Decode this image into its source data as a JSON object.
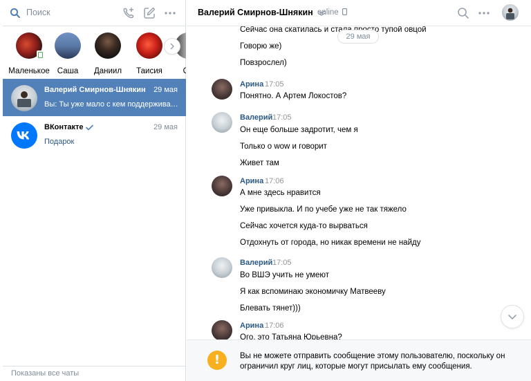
{
  "colors": {
    "accent": "#5181b8",
    "link": "#2a5885",
    "warning": "#f8b020"
  },
  "search": {
    "placeholder": "Поиск"
  },
  "toolbar": {
    "icons": [
      "call-plus-icon",
      "compose-icon",
      "more-icon"
    ]
  },
  "stories": [
    {
      "name": "Маленькое",
      "online": true
    },
    {
      "name": "Саша",
      "online": false
    },
    {
      "name": "Даниил",
      "online": false
    },
    {
      "name": "Таисия",
      "online": false
    },
    {
      "name": "Се",
      "online": false
    }
  ],
  "chats": [
    {
      "name": "Валерий Смирнов-Шнякин",
      "date": "29 мая",
      "message": "Вы: Ты уже мало с кем поддерживаешь общение",
      "active": true
    },
    {
      "name": "ВКонтакте",
      "date": "29 мая",
      "message": "Подарок",
      "verified": true,
      "active": false
    }
  ],
  "left_footer": "Показаны все чаты",
  "header": {
    "name": "Валерий Смирнов-Шнякин",
    "status": "online"
  },
  "date_divider": "29 мая",
  "messages": {
    "top_line_0": "Сейчас она скатилась и стала просто тупой овцой",
    "top_line_1": "Говорю же)",
    "top_line_2": "Повзрослел)",
    "g1": {
      "author": "Арина",
      "time": "17:05",
      "lines": [
        "Понятно. А Артем Локостов?"
      ]
    },
    "g2": {
      "author": "Валерий",
      "time": "17:05",
      "lines": [
        "Он еще больше задротит, чем я",
        "Только о wow и говорит",
        "Живет там"
      ]
    },
    "g3": {
      "author": "Арина",
      "time": "17:06",
      "lines": [
        "А мне здесь нравится",
        "Уже привыкла. И по учебе уже не так тяжело",
        "Сейчас хочется куда-то вырваться",
        "Отдохнуть от города, но никак времени не найду"
      ]
    },
    "g4": {
      "author": "Валерий",
      "time": "17:05",
      "lines": [
        "Во ВШЭ учить не умеют",
        "Я как вспоминаю экономичку Матвееву",
        "Блевать тянет)))"
      ]
    },
    "g5": {
      "author": "Арина",
      "time": "17:06",
      "lines": [
        "Ого, это Татьяна Юрьевна?"
      ]
    }
  },
  "notice": {
    "text": "Вы не можете отправить сообщение этому пользователю, поскольку он ограничил круг лиц, которые могут присылать ему сообщения."
  }
}
